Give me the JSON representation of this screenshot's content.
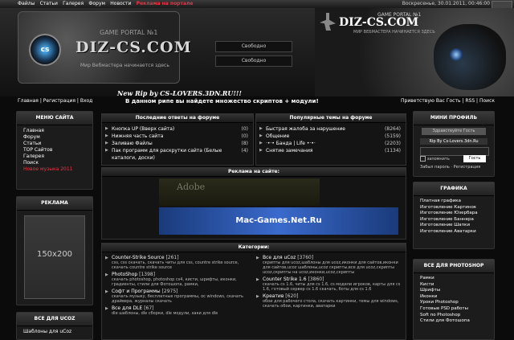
{
  "topbar": {
    "items": [
      "Файлы",
      "Статьи",
      "Галерея",
      "Форум",
      "Новости"
    ],
    "highlight": "Реклама на портале",
    "date": "Воскресенье, 30.01.2011, 00:46:00"
  },
  "logo": {
    "circle": "cs",
    "title": "DIZ-CS.COM",
    "subtitle": "GAME PORTAL №1",
    "tagline": "Мир Вебмастера начинается здесь"
  },
  "free_slots": [
    "Свободно",
    "Свободно"
  ],
  "right_banner": {
    "title": "DIZ-CS.COM",
    "subtitle": "GAME PORTAL №1",
    "tagline": "МИР ВЕБМАСТЕРА НАЧИНАЕТСЯ ЗДЕСЬ"
  },
  "rip": {
    "line1": "New Rip by CS-LOVERS.3DN.RU!!!",
    "line2": "В данном рипе вы найдете множество скриптов + модули!"
  },
  "nav2": {
    "left": [
      "Главная",
      "Регистрация",
      "Вход"
    ],
    "right": [
      "Приветствую Вас Гость",
      "RSS",
      "Поиск"
    ]
  },
  "site_menu": {
    "title": "МЕНЮ САЙТА",
    "items": [
      "Главная",
      "Форум",
      "Статьи",
      "TOP Сайтов",
      "Галерея",
      "Поиск"
    ],
    "red_item": "Новое музыка 2011"
  },
  "ads": {
    "title": "РЕКЛАМА",
    "placeholder": "150x200"
  },
  "ucoz_block": {
    "title": "ВСЕ ДЛЯ UCOZ",
    "items": [
      "Шаблоны для uCoz"
    ]
  },
  "forum_latest": {
    "title": "Последние ответы на форуме",
    "rows": [
      {
        "text": "Кнопка UP (Вверх сайта)",
        "count": "(0)"
      },
      {
        "text": "Нижняя часть сайта",
        "count": "(0)"
      },
      {
        "text": "Заливаю Файлы",
        "count": "(8)"
      },
      {
        "text": "Пак программ для раскрутки сайта (Белые каталоги, доски)",
        "count": "(4)"
      }
    ]
  },
  "forum_popular": {
    "title": "Популярные темы на форуме",
    "rows": [
      {
        "text": "Быстрая жалоба за нарушение",
        "count": "(8264)"
      },
      {
        "text": "Общение",
        "count": "(5159)"
      },
      {
        "text": "·•·• Банда | Life •·•·",
        "count": "(2203)"
      },
      {
        "text": "Снятие замечания",
        "count": "(1134)"
      }
    ]
  },
  "site_ads": {
    "title": "Реклама на сайте:",
    "banner1": "Adobe",
    "banner2": "Mac-Games.Net.Ru"
  },
  "categories": {
    "title": "Категории:",
    "left": [
      {
        "name": "Counter-Strike Source",
        "num": "[261]",
        "desc": "css, css скачать, скачать читы для css, countre strike source, скачать countre strike source"
      },
      {
        "name": "PhotoShop",
        "num": "[1398]",
        "desc": "скачать photoshop, photoshop cs4, кисти, шрифты, иконки, градиенты, стили для Фотошопа, рамки,"
      },
      {
        "name": "Софт и Программы",
        "num": "[2975]",
        "desc": "скачать музыку, бесплатные программы, ос windows, скачать драйвера, журналы скачать"
      },
      {
        "name": "Все для DLE",
        "num": "[67]",
        "desc": "dle шаблоны, dle сборки, dle модули, хаки для dle"
      }
    ],
    "right": [
      {
        "name": "Все для uCoz",
        "num": "[3760]",
        "desc": "скрипты для ucoz,шаблоны для ucoz,иконки для сайтов,иконки для сайтов,ucoz шаблоны,ucoz скрипты,все для ucoz,скрипты ucoz,скрипты на ucoz,иконки,ucoz,скрипты"
      },
      {
        "name": "Counter Strike 1.6",
        "num": "[3860]",
        "desc": "скачать cs 1.6, читы для cs 1.6, cs модели игроков, карты для cs 1.6, готовый сервер cs 1.6 скачать, боты для cs 1.6"
      },
      {
        "name": "Креатив",
        "num": "[620]",
        "desc": "обои для рабочего стола, скачать картинки, темы для windows, скачать обои, картинки, аватарки"
      }
    ]
  },
  "mini_profile": {
    "title": "МИНИ ПРОФИЛЬ",
    "greeting": "Здравствуйте Гость",
    "ribbon": "Rip By Cs-Lovers.3dn.Ru",
    "remember": "запомнить",
    "guest_tag": "Гость",
    "forgot": "Забыл пароль · Регистрация"
  },
  "graphics": {
    "title": "ГРАФИКА",
    "items": [
      "Платная графика",
      "Изготовление Картинок",
      "Изготовление Юзербара",
      "Изготовление Баннера",
      "Изготовление Шапки",
      "Изготовление Аватарки"
    ]
  },
  "photoshop": {
    "title": "ВСЕ ДЛЯ PHOTOSHOP",
    "items": [
      "Рамки",
      "Кисти",
      "Шрифты",
      "Иконки",
      "Уроки Photoshop",
      "Готовые PSD работы",
      "Soft по Photoshop",
      "Стили для Фотошопа"
    ]
  }
}
